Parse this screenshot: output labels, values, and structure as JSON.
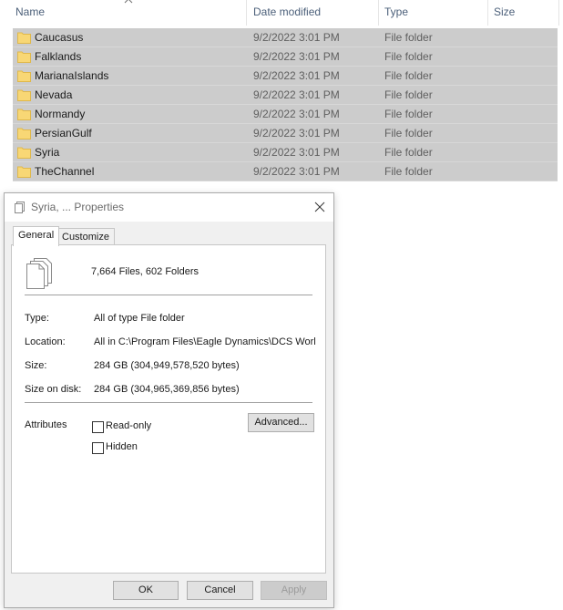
{
  "explorer": {
    "columns": {
      "name": "Name",
      "date_modified": "Date modified",
      "type": "Type",
      "size": "Size"
    },
    "rows": [
      {
        "name": "Caucasus",
        "date": "9/2/2022 3:01 PM",
        "type": "File folder"
      },
      {
        "name": "Falklands",
        "date": "9/2/2022 3:01 PM",
        "type": "File folder"
      },
      {
        "name": "MarianaIslands",
        "date": "9/2/2022 3:01 PM",
        "type": "File folder"
      },
      {
        "name": "Nevada",
        "date": "9/2/2022 3:01 PM",
        "type": "File folder"
      },
      {
        "name": "Normandy",
        "date": "9/2/2022 3:01 PM",
        "type": "File folder"
      },
      {
        "name": "PersianGulf",
        "date": "9/2/2022 3:01 PM",
        "type": "File folder"
      },
      {
        "name": "Syria",
        "date": "9/2/2022 3:01 PM",
        "type": "File folder"
      },
      {
        "name": "TheChannel",
        "date": "9/2/2022 3:01 PM",
        "type": "File folder"
      }
    ],
    "folder_icon_color": "#f8d775"
  },
  "dialog": {
    "title": "Syria, ... Properties",
    "tabs": [
      "General",
      "Customize"
    ],
    "summary": "7,664 Files, 602 Folders",
    "type_label": "Type:",
    "type_value": "All of type File folder",
    "location_label": "Location:",
    "location_value": "All in C:\\Program Files\\Eagle Dynamics\\DCS World OpenBeta\\Mods\\terrains",
    "size_label": "Size:",
    "size_value": "284 GB (304,949,578,520 bytes)",
    "size_on_disk_label": "Size on disk:",
    "size_on_disk_value": "284 GB (304,965,369,856 bytes)",
    "attributes_label": "Attributes",
    "readonly_label": "Read-only",
    "hidden_label": "Hidden",
    "advanced_button": "Advanced...",
    "ok_button": "OK",
    "cancel_button": "Cancel",
    "apply_button": "Apply"
  }
}
